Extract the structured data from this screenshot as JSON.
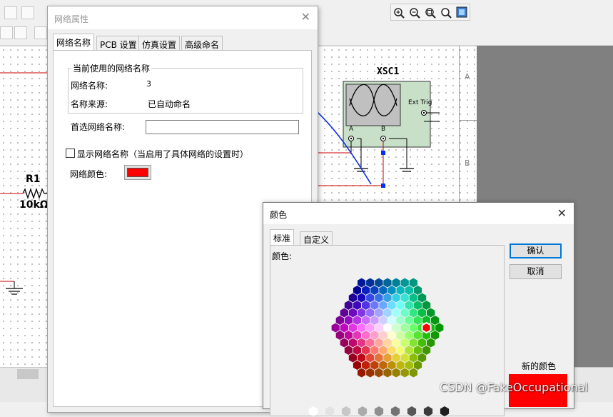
{
  "app": {
    "zoom_icons": [
      "zoom-in-icon",
      "zoom-out-icon",
      "zoom-area-icon",
      "zoom-fit-icon",
      "full-screen-icon"
    ],
    "schematic": {
      "component_ref": "R1",
      "component_value": "10kΩ",
      "instrument_name": "XSC1",
      "ext_trig_label": "Ext Trig",
      "channel_a": "A",
      "channel_b": "B",
      "border_row_a": "A",
      "border_row_b": "B"
    },
    "watermark": "CSDN @FakeOccupational"
  },
  "net_dialog": {
    "title": "网络属性",
    "tabs": [
      {
        "label": "网络名称",
        "active": true
      },
      {
        "label": "PCB 设置",
        "active": false
      },
      {
        "label": "仿真设置",
        "active": false
      },
      {
        "label": "高级命名",
        "active": false
      }
    ],
    "current_group": {
      "legend": "当前使用的网络名称",
      "name_label": "网络名称:",
      "name_value": "3",
      "source_label": "名称来源:",
      "source_value": "已自动命名"
    },
    "preferred_label": "首选网络名称:",
    "preferred_value": "",
    "show_name_label": "显示网络名称（当启用了具体网络的设置时）",
    "show_name_checked": false,
    "net_color_label": "网络颜色:",
    "net_color": "#ff0000"
  },
  "color_dialog": {
    "title": "颜色",
    "tabs": [
      {
        "label": "标准",
        "active": true
      },
      {
        "label": "自定义",
        "active": false
      }
    ],
    "colors_label": "颜色:",
    "ok_label": "确认",
    "cancel_label": "取消",
    "new_color_label": "新的颜色",
    "selected_color": "#ff0000"
  },
  "colors": {
    "accent_blue": "#0078d7",
    "wire_red": "#cc0000",
    "annotation_blue": "#1030e0",
    "scope_body": "#c8e0c8"
  }
}
